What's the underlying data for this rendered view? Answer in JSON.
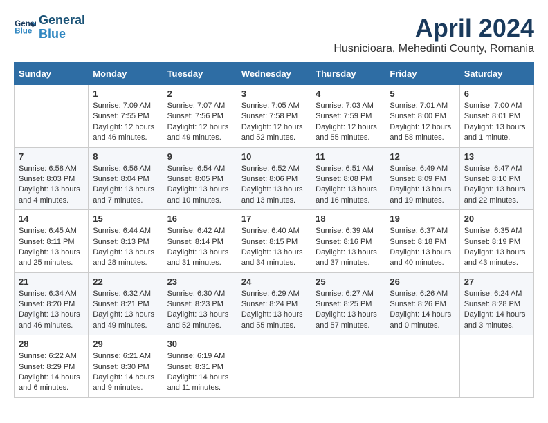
{
  "header": {
    "logo_line1": "General",
    "logo_line2": "Blue",
    "month": "April 2024",
    "location": "Husnicioara, Mehedinti County, Romania"
  },
  "days_of_week": [
    "Sunday",
    "Monday",
    "Tuesday",
    "Wednesday",
    "Thursday",
    "Friday",
    "Saturday"
  ],
  "weeks": [
    [
      {
        "day": "",
        "content": ""
      },
      {
        "day": "1",
        "content": "Sunrise: 7:09 AM\nSunset: 7:55 PM\nDaylight: 12 hours\nand 46 minutes."
      },
      {
        "day": "2",
        "content": "Sunrise: 7:07 AM\nSunset: 7:56 PM\nDaylight: 12 hours\nand 49 minutes."
      },
      {
        "day": "3",
        "content": "Sunrise: 7:05 AM\nSunset: 7:58 PM\nDaylight: 12 hours\nand 52 minutes."
      },
      {
        "day": "4",
        "content": "Sunrise: 7:03 AM\nSunset: 7:59 PM\nDaylight: 12 hours\nand 55 minutes."
      },
      {
        "day": "5",
        "content": "Sunrise: 7:01 AM\nSunset: 8:00 PM\nDaylight: 12 hours\nand 58 minutes."
      },
      {
        "day": "6",
        "content": "Sunrise: 7:00 AM\nSunset: 8:01 PM\nDaylight: 13 hours\nand 1 minute."
      }
    ],
    [
      {
        "day": "7",
        "content": "Sunrise: 6:58 AM\nSunset: 8:03 PM\nDaylight: 13 hours\nand 4 minutes."
      },
      {
        "day": "8",
        "content": "Sunrise: 6:56 AM\nSunset: 8:04 PM\nDaylight: 13 hours\nand 7 minutes."
      },
      {
        "day": "9",
        "content": "Sunrise: 6:54 AM\nSunset: 8:05 PM\nDaylight: 13 hours\nand 10 minutes."
      },
      {
        "day": "10",
        "content": "Sunrise: 6:52 AM\nSunset: 8:06 PM\nDaylight: 13 hours\nand 13 minutes."
      },
      {
        "day": "11",
        "content": "Sunrise: 6:51 AM\nSunset: 8:08 PM\nDaylight: 13 hours\nand 16 minutes."
      },
      {
        "day": "12",
        "content": "Sunrise: 6:49 AM\nSunset: 8:09 PM\nDaylight: 13 hours\nand 19 minutes."
      },
      {
        "day": "13",
        "content": "Sunrise: 6:47 AM\nSunset: 8:10 PM\nDaylight: 13 hours\nand 22 minutes."
      }
    ],
    [
      {
        "day": "14",
        "content": "Sunrise: 6:45 AM\nSunset: 8:11 PM\nDaylight: 13 hours\nand 25 minutes."
      },
      {
        "day": "15",
        "content": "Sunrise: 6:44 AM\nSunset: 8:13 PM\nDaylight: 13 hours\nand 28 minutes."
      },
      {
        "day": "16",
        "content": "Sunrise: 6:42 AM\nSunset: 8:14 PM\nDaylight: 13 hours\nand 31 minutes."
      },
      {
        "day": "17",
        "content": "Sunrise: 6:40 AM\nSunset: 8:15 PM\nDaylight: 13 hours\nand 34 minutes."
      },
      {
        "day": "18",
        "content": "Sunrise: 6:39 AM\nSunset: 8:16 PM\nDaylight: 13 hours\nand 37 minutes."
      },
      {
        "day": "19",
        "content": "Sunrise: 6:37 AM\nSunset: 8:18 PM\nDaylight: 13 hours\nand 40 minutes."
      },
      {
        "day": "20",
        "content": "Sunrise: 6:35 AM\nSunset: 8:19 PM\nDaylight: 13 hours\nand 43 minutes."
      }
    ],
    [
      {
        "day": "21",
        "content": "Sunrise: 6:34 AM\nSunset: 8:20 PM\nDaylight: 13 hours\nand 46 minutes."
      },
      {
        "day": "22",
        "content": "Sunrise: 6:32 AM\nSunset: 8:21 PM\nDaylight: 13 hours\nand 49 minutes."
      },
      {
        "day": "23",
        "content": "Sunrise: 6:30 AM\nSunset: 8:23 PM\nDaylight: 13 hours\nand 52 minutes."
      },
      {
        "day": "24",
        "content": "Sunrise: 6:29 AM\nSunset: 8:24 PM\nDaylight: 13 hours\nand 55 minutes."
      },
      {
        "day": "25",
        "content": "Sunrise: 6:27 AM\nSunset: 8:25 PM\nDaylight: 13 hours\nand 57 minutes."
      },
      {
        "day": "26",
        "content": "Sunrise: 6:26 AM\nSunset: 8:26 PM\nDaylight: 14 hours\nand 0 minutes."
      },
      {
        "day": "27",
        "content": "Sunrise: 6:24 AM\nSunset: 8:28 PM\nDaylight: 14 hours\nand 3 minutes."
      }
    ],
    [
      {
        "day": "28",
        "content": "Sunrise: 6:22 AM\nSunset: 8:29 PM\nDaylight: 14 hours\nand 6 minutes."
      },
      {
        "day": "29",
        "content": "Sunrise: 6:21 AM\nSunset: 8:30 PM\nDaylight: 14 hours\nand 9 minutes."
      },
      {
        "day": "30",
        "content": "Sunrise: 6:19 AM\nSunset: 8:31 PM\nDaylight: 14 hours\nand 11 minutes."
      },
      {
        "day": "",
        "content": ""
      },
      {
        "day": "",
        "content": ""
      },
      {
        "day": "",
        "content": ""
      },
      {
        "day": "",
        "content": ""
      }
    ]
  ]
}
